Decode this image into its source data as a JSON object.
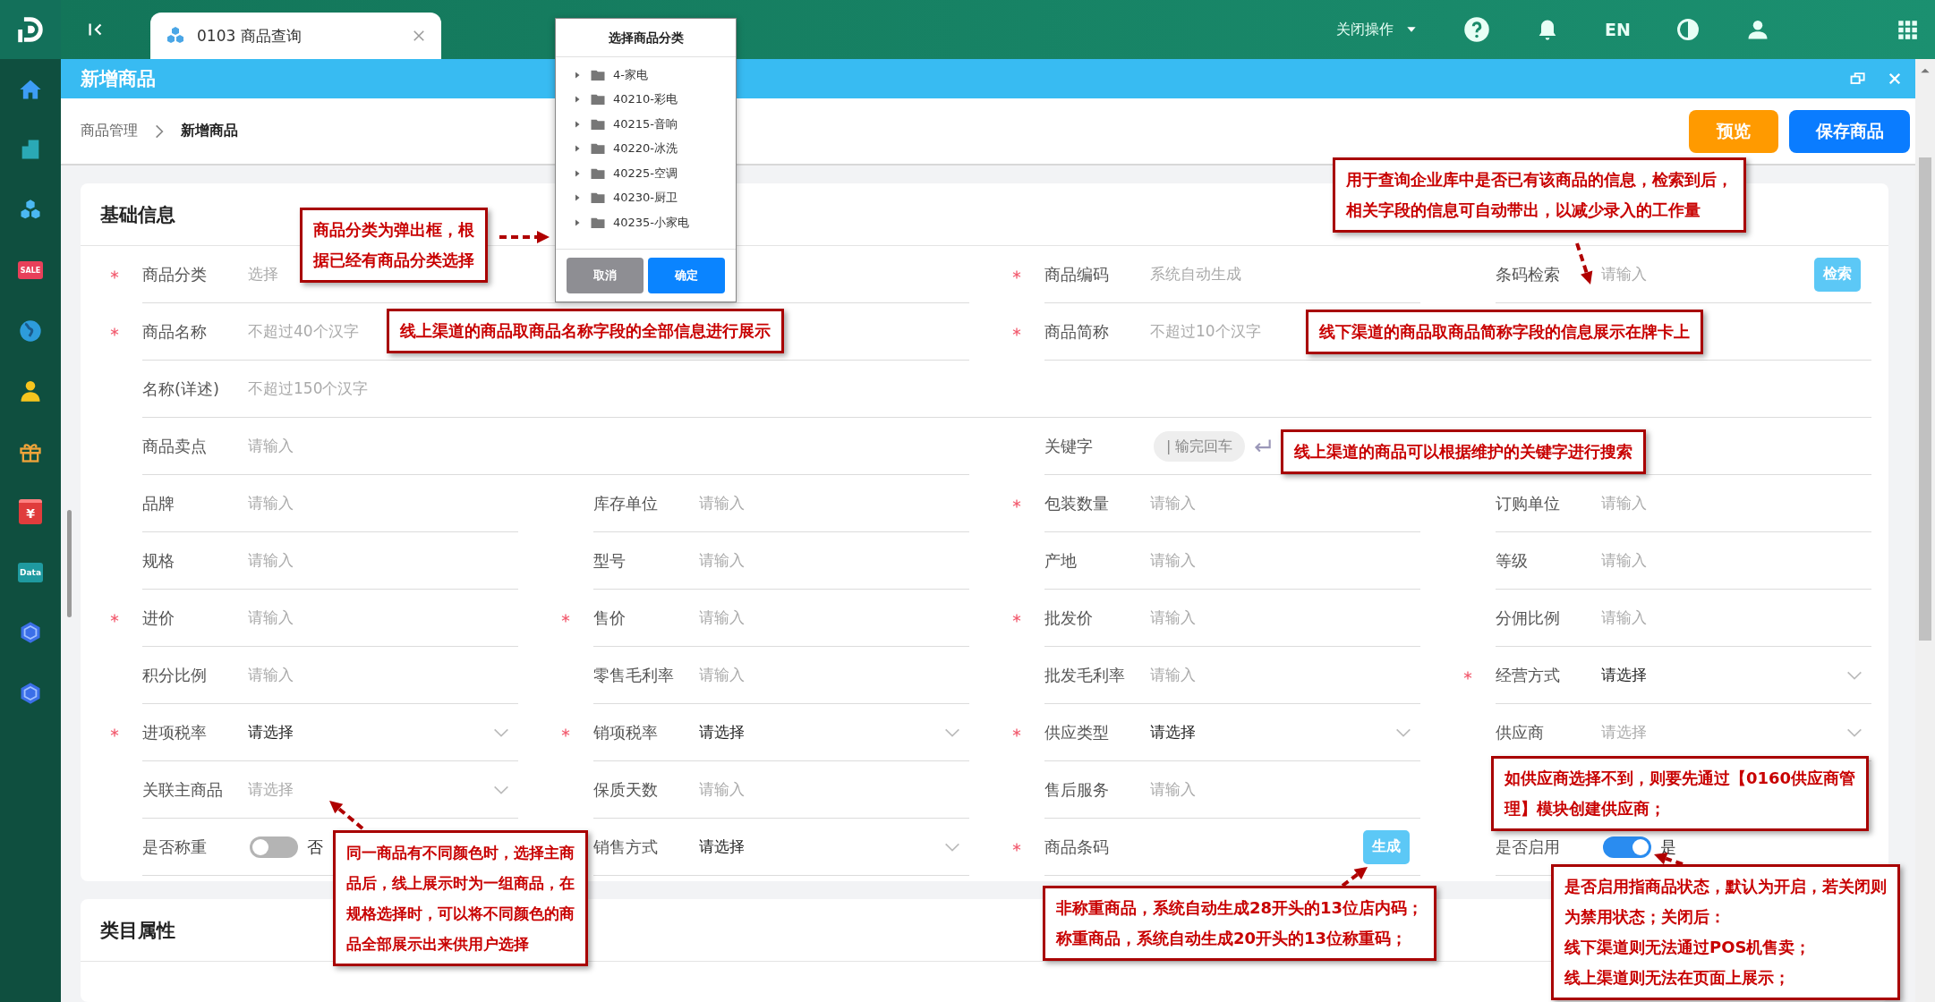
{
  "sidebar": {
    "items": [
      {
        "kind": "home"
      },
      {
        "kind": "building"
      },
      {
        "kind": "cubes"
      },
      {
        "kind": "tag",
        "text": "SALE"
      },
      {
        "kind": "globe"
      },
      {
        "kind": "person"
      },
      {
        "kind": "gift"
      },
      {
        "kind": "box",
        "text": "¥"
      },
      {
        "kind": "data",
        "text": "Data"
      },
      {
        "kind": "hexagon"
      },
      {
        "kind": "hexagon"
      }
    ]
  },
  "top_bar": {
    "tabs": [
      {
        "label": "0103 商品查询",
        "selected": true
      }
    ],
    "close_menu": "关闭操作",
    "language": "EN"
  },
  "dialog": {
    "title": "选择商品分类",
    "items": [
      {
        "label": "4-家电",
        "expanded": false
      },
      {
        "label": "40210-彩电",
        "expanded": false
      },
      {
        "label": "40215-音响",
        "expanded": false
      },
      {
        "label": "40220-冰洗",
        "expanded": false
      },
      {
        "label": "40225-空调",
        "expanded": false
      },
      {
        "label": "40230-厨卫",
        "expanded": false
      },
      {
        "label": "40235-小家电",
        "expanded": false
      }
    ],
    "buttons": [
      {
        "label": "取消",
        "kind": "secondary"
      },
      {
        "label": "确定",
        "kind": "primary"
      }
    ]
  },
  "page": {
    "title": "新增商品",
    "breadcrumb": [
      "商品管理",
      "新增商品"
    ],
    "buttons": [
      {
        "label": "预览",
        "kind": "preview"
      },
      {
        "label": "保存商品",
        "kind": "primary"
      }
    ]
  },
  "sections": [
    {
      "title": "基础信息",
      "rows": [
        [
          {
            "label": "商品分类",
            "required": true,
            "kind": "input",
            "placeholder": "选择"
          },
          "",
          {
            "label": "商品编码",
            "required": true,
            "kind": "input",
            "placeholder": "系统自动生成"
          },
          {
            "label": "条码检索",
            "required": false,
            "kind": "search",
            "placeholder": "请输入",
            "button": "检索"
          }
        ],
        [
          {
            "label": "商品名称",
            "required": true,
            "kind": "input",
            "placeholder": "不超过40个汉字"
          },
          "",
          {
            "label": "商品简称",
            "required": true,
            "kind": "input",
            "placeholder": "不超过10个汉字"
          },
          ""
        ],
        [
          {
            "label": "名称(详述)",
            "required": false,
            "kind": "input",
            "placeholder": "不超过150个汉字"
          },
          "",
          "",
          ""
        ],
        [
          {
            "label": "商品卖点",
            "required": false,
            "kind": "input",
            "placeholder": "请输入"
          },
          "",
          {
            "label": "关键字",
            "required": false,
            "kind": "keyword",
            "placeholder": "| 输完回车"
          },
          ""
        ],
        [
          {
            "label": "品牌",
            "required": false,
            "kind": "input",
            "placeholder": "请输入"
          },
          {
            "label": "库存单位",
            "required": false,
            "kind": "input",
            "placeholder": "请输入"
          },
          {
            "label": "包装数量",
            "required": true,
            "kind": "input",
            "placeholder": "请输入"
          },
          {
            "label": "订购单位",
            "required": false,
            "kind": "input",
            "placeholder": "请输入"
          }
        ],
        [
          {
            "label": "规格",
            "required": false,
            "kind": "input",
            "placeholder": "请输入"
          },
          {
            "label": "型号",
            "required": false,
            "kind": "input",
            "placeholder": "请输入"
          },
          {
            "label": "产地",
            "required": false,
            "kind": "input",
            "placeholder": "请输入"
          },
          {
            "label": "等级",
            "required": false,
            "kind": "input",
            "placeholder": "请输入"
          }
        ],
        [
          {
            "label": "进价",
            "required": true,
            "kind": "input",
            "placeholder": "请输入"
          },
          {
            "label": "售价",
            "required": true,
            "kind": "input",
            "placeholder": "请输入"
          },
          {
            "label": "批发价",
            "required": true,
            "kind": "input",
            "placeholder": "请输入"
          },
          {
            "label": "分佣比例",
            "required": false,
            "kind": "input",
            "placeholder": "请输入"
          }
        ],
        [
          {
            "label": "积分比例",
            "required": false,
            "kind": "input",
            "placeholder": "请输入"
          },
          {
            "label": "零售毛利率",
            "required": false,
            "kind": "input",
            "placeholder": "请输入"
          },
          {
            "label": "批发毛利率",
            "required": false,
            "kind": "input",
            "placeholder": "请输入"
          },
          {
            "label": "经营方式",
            "required": true,
            "kind": "select",
            "value": "请选择"
          }
        ],
        [
          {
            "label": "进项税率",
            "required": true,
            "kind": "select",
            "value": "请选择"
          },
          {
            "label": "销项税率",
            "required": true,
            "kind": "select",
            "value": "请选择"
          },
          {
            "label": "供应类型",
            "required": true,
            "kind": "select",
            "value": "请选择"
          },
          {
            "label": "供应商",
            "required": false,
            "kind": "select",
            "placeholder": "请选择"
          }
        ],
        [
          {
            "label": "关联主商品",
            "required": false,
            "kind": "select",
            "placeholder": "请选择"
          },
          {
            "label": "保质天数",
            "required": false,
            "kind": "input",
            "placeholder": "请输入"
          },
          {
            "label": "售后服务",
            "required": false,
            "kind": "input",
            "placeholder": "请输入"
          }
        ],
        [
          {
            "label": "是否称重",
            "required": false,
            "kind": "toggle",
            "on": false,
            "state_text": "否"
          },
          {
            "label": "销售方式",
            "required": false,
            "kind": "select",
            "value": "请选择"
          },
          {
            "label": "商品条码",
            "required": true,
            "kind": "barcode",
            "button": "生成"
          },
          {
            "label": "是否启用",
            "required": false,
            "kind": "toggle",
            "on": true,
            "state_text": "是"
          }
        ]
      ]
    },
    {
      "title": "类目属性"
    }
  ],
  "annotations": [
    {
      "lines": [
        "商品分类为弹出框，根",
        "据已经有商品分类选择"
      ]
    },
    {
      "lines": [
        "线上渠道的商品取商品名称字段的全部信息进行展示"
      ]
    },
    {
      "lines": [
        "用于查询企业库中是否已有该商品的信息，检索到后，",
        "相关字段的信息可自动带出，以减少录入的工作量"
      ]
    },
    {
      "lines": [
        "线下渠道的商品取商品简称字段的信息展示在牌卡上"
      ]
    },
    {
      "lines": [
        "线上渠道的商品可以根据维护的关键字进行搜索"
      ]
    },
    {
      "lines": [
        "如供应商选择不到，则要先通过【0160供应商管",
        "理】模块创建供应商；"
      ]
    },
    {
      "lines": [
        "同一商品有不同颜色时，选择主商",
        "品后，线上展示时为一组商品，在",
        "规格选择时，可以将不同颜色的商",
        "品全部展示出来供用户选择"
      ]
    },
    {
      "lines": [
        "非称重商品，系统自动生成28开头的13位店内码；",
        "称重商品，系统自动生成20开头的13位称重码；"
      ]
    },
    {
      "lines": [
        "是否启用指商品状态，默认为开启，若关闭则",
        "为禁用状态；关闭后：",
        "线下渠道则无法通过POS机售卖；",
        "线上渠道则无法在页面上展示；"
      ]
    }
  ]
}
